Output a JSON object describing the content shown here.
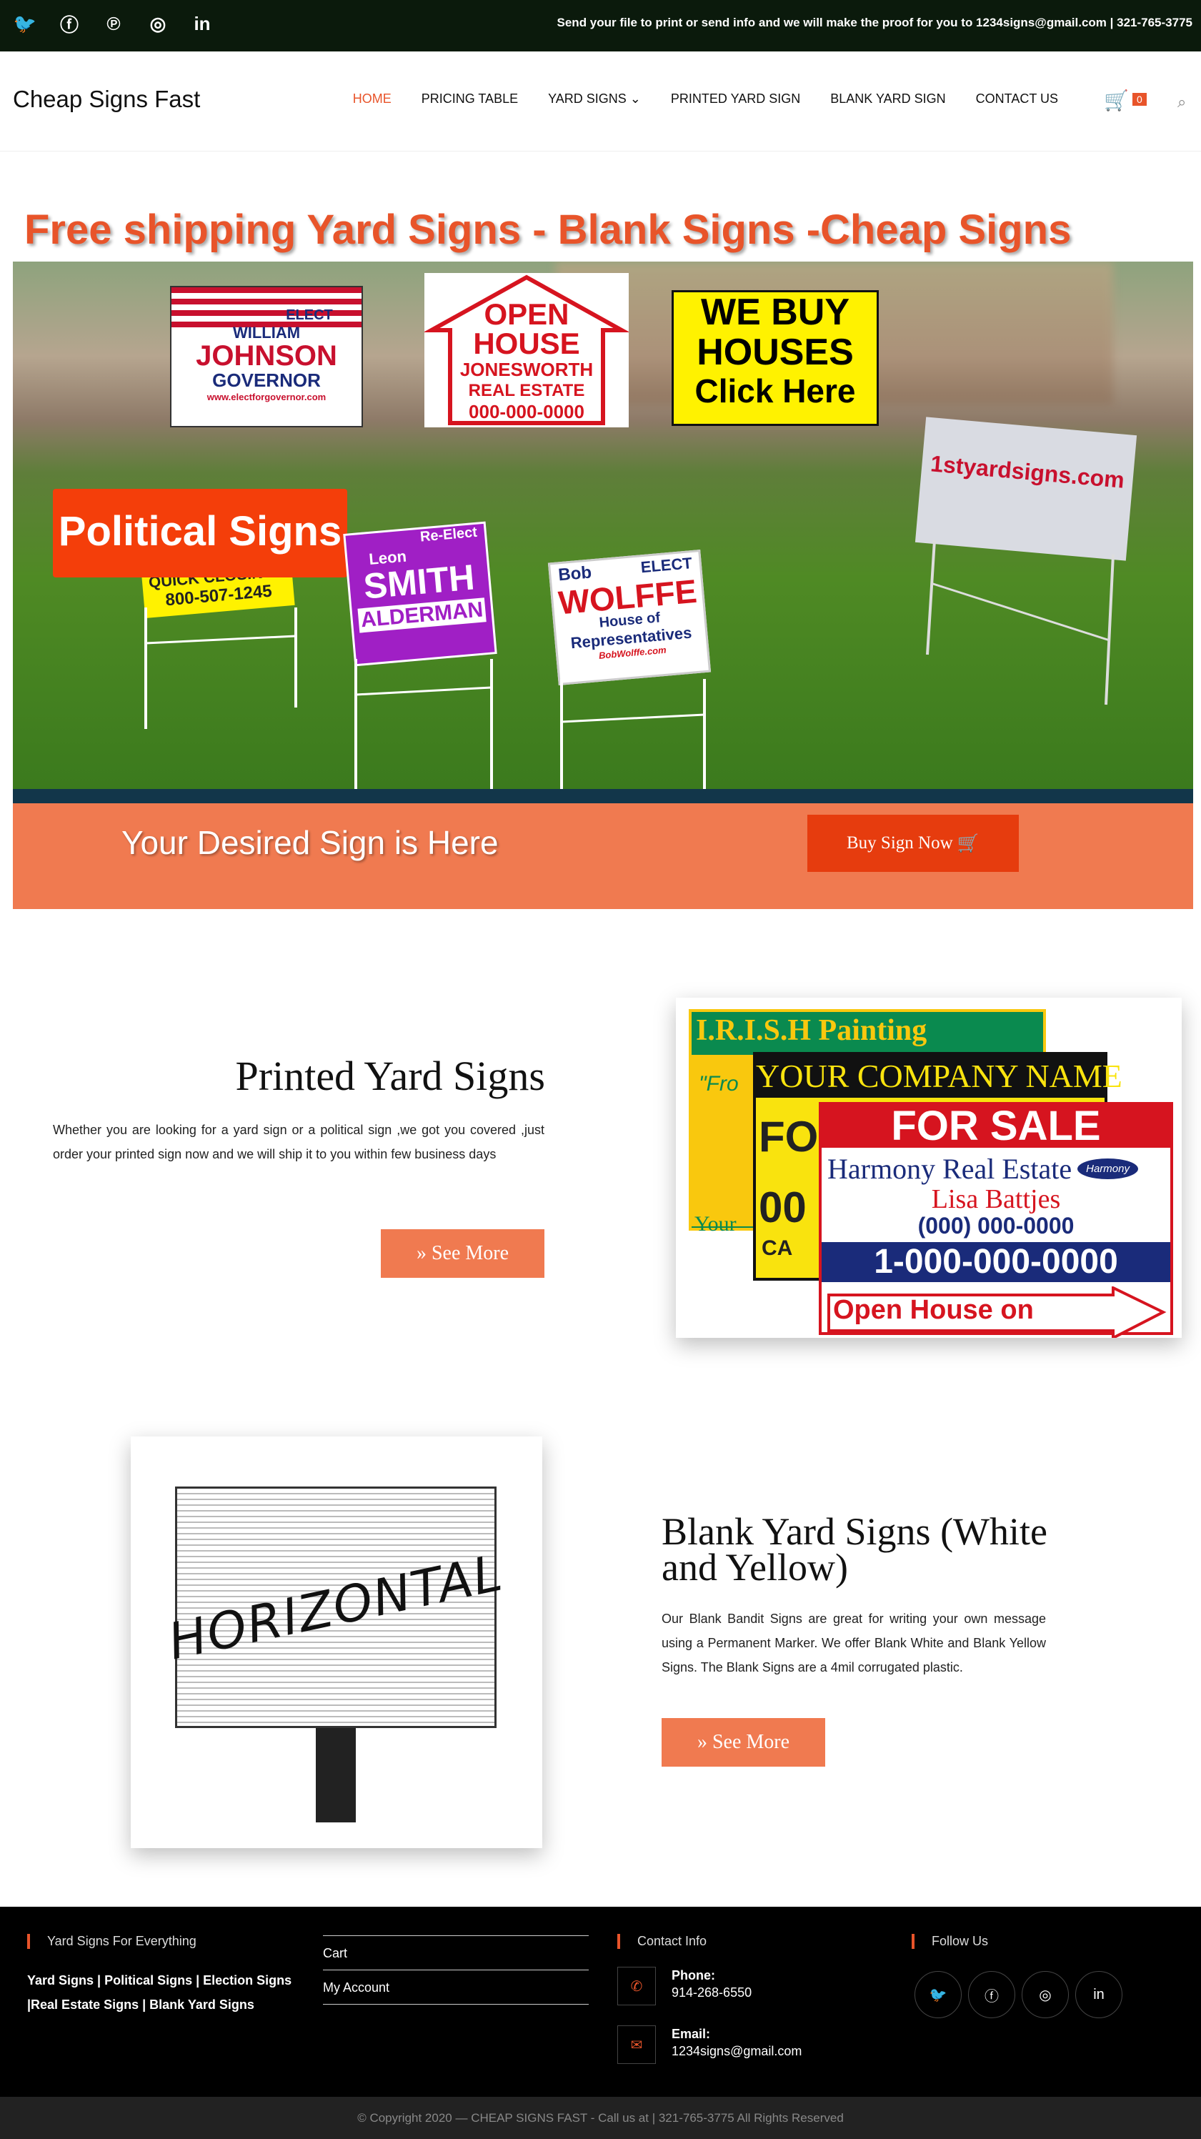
{
  "topbar": {
    "message": "Send your file to print or send info and we will make the proof for you to 1234signs@gmail.com | 321-765-3775",
    "social": [
      "twitter-icon",
      "facebook-icon",
      "pinterest-icon",
      "instagram-icon",
      "linkedin-icon"
    ]
  },
  "header": {
    "logo": "Cheap Signs Fast",
    "nav": [
      "HOME",
      "PRICING TABLE",
      "YARD SIGNS",
      "PRINTED YARD SIGN",
      "BLANK YARD SIGN",
      "CONTACT US"
    ],
    "cart_count": "0"
  },
  "hero": {
    "title": "Free shipping Yard Signs - Blank Signs -Cheap Signs",
    "badge": "Political Signs",
    "signs": {
      "elect": [
        "ELECT",
        "WILLIAM",
        "JOHNSON",
        "GOVERNOR",
        "www.electforgovernor.com"
      ],
      "open": [
        "OPEN",
        "HOUSE",
        "JONESWORTH",
        "REAL ESTATE",
        "000-000-0000"
      ],
      "webuy": [
        "WE BUY",
        "HOUSES",
        "Click Here"
      ],
      "yard": "1styardsigns.com",
      "quick": [
        "QUICK CLOSINGS",
        "800-507-1245"
      ],
      "smith": [
        "Re-Elect",
        "Leon",
        "SMITH",
        "ALDERMAN"
      ],
      "wolffe": [
        "Bob",
        "ELECT",
        "WOLFFE",
        "House of",
        "Representatives",
        "BobWolffe.com"
      ]
    }
  },
  "cta": {
    "text": "Your Desired Sign is Here",
    "button": "Buy Sign Now"
  },
  "section1": {
    "title": "Printed Yard Signs",
    "text": "Whether you are looking for a yard sign or a political sign ,we got you covered ,just order your printed sign now and we will ship it to you within few business days",
    "button": "See More",
    "image_text": [
      "I.R.I.S.H  Painting",
      "\"Fro",
      "Your",
      "YOUR COMPANY NAME",
      "FOR",
      "00",
      "CA",
      "FOR SALE",
      "Harmony Real Estate",
      "Harmony",
      "Lisa Battjes",
      "(000) 000-0000",
      "1-000-000-0000",
      "Open House on"
    ]
  },
  "section2": {
    "title": "Blank Yard Signs (White and Yellow)",
    "text": "Our Blank Bandit Signs are great for writing your own message using a Permanent Marker. We offer Blank White and Blank Yellow Signs. The Blank Signs are a 4mil corrugated plastic.",
    "button": "See More",
    "image_text": "HORIZONTAL"
  },
  "footer": {
    "col1_title": "Yard Signs For Everything",
    "col1_text": "Yard Signs | Political Signs | Election Signs |Real Estate Signs | Blank Yard Signs",
    "links": [
      "Cart",
      "My Account"
    ],
    "contact_title": "Contact Info",
    "phone_label": "Phone:",
    "phone": "914-268-6550",
    "email_label": "Email:",
    "email": "1234signs@gmail.com",
    "follow_title": "Follow Us"
  },
  "copyright": "© Copyright 2020 — CHEAP SIGNS FAST - Call us at | 321-765-3775 All Rights Reserved"
}
